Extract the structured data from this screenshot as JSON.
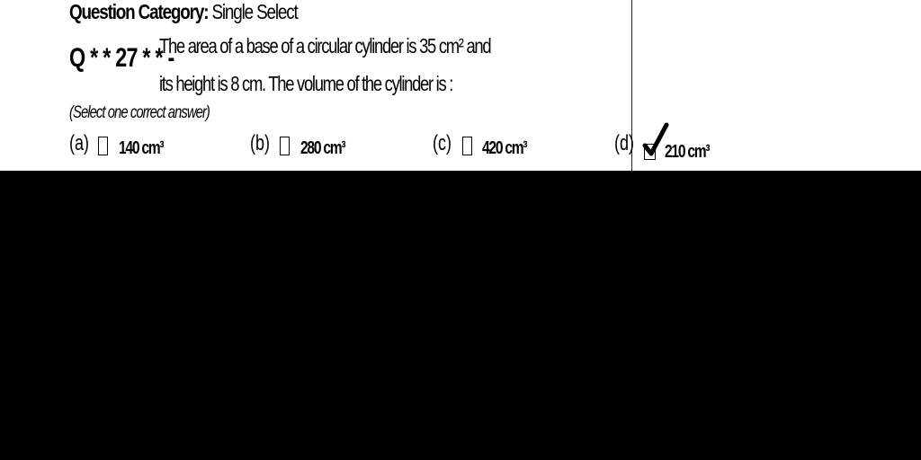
{
  "question": {
    "category_label": "Question Category:",
    "category_value": "Single Select",
    "number": "Q * * 27 * * -",
    "text_line1": "The area of a base of a circular cylinder is 35 cm² and",
    "text_line2": "its height is 8 cm. The volume of the cylinder is :",
    "instruction": "(Select one correct answer)"
  },
  "options": [
    {
      "letter": "(a)",
      "value": "140 cm³",
      "checked": false
    },
    {
      "letter": "(b)",
      "value": "280 cm³",
      "checked": false
    },
    {
      "letter": "(c)",
      "value": "420 cm³",
      "checked": false
    },
    {
      "letter": "(d)",
      "value": "210 cm³",
      "checked": true
    }
  ]
}
